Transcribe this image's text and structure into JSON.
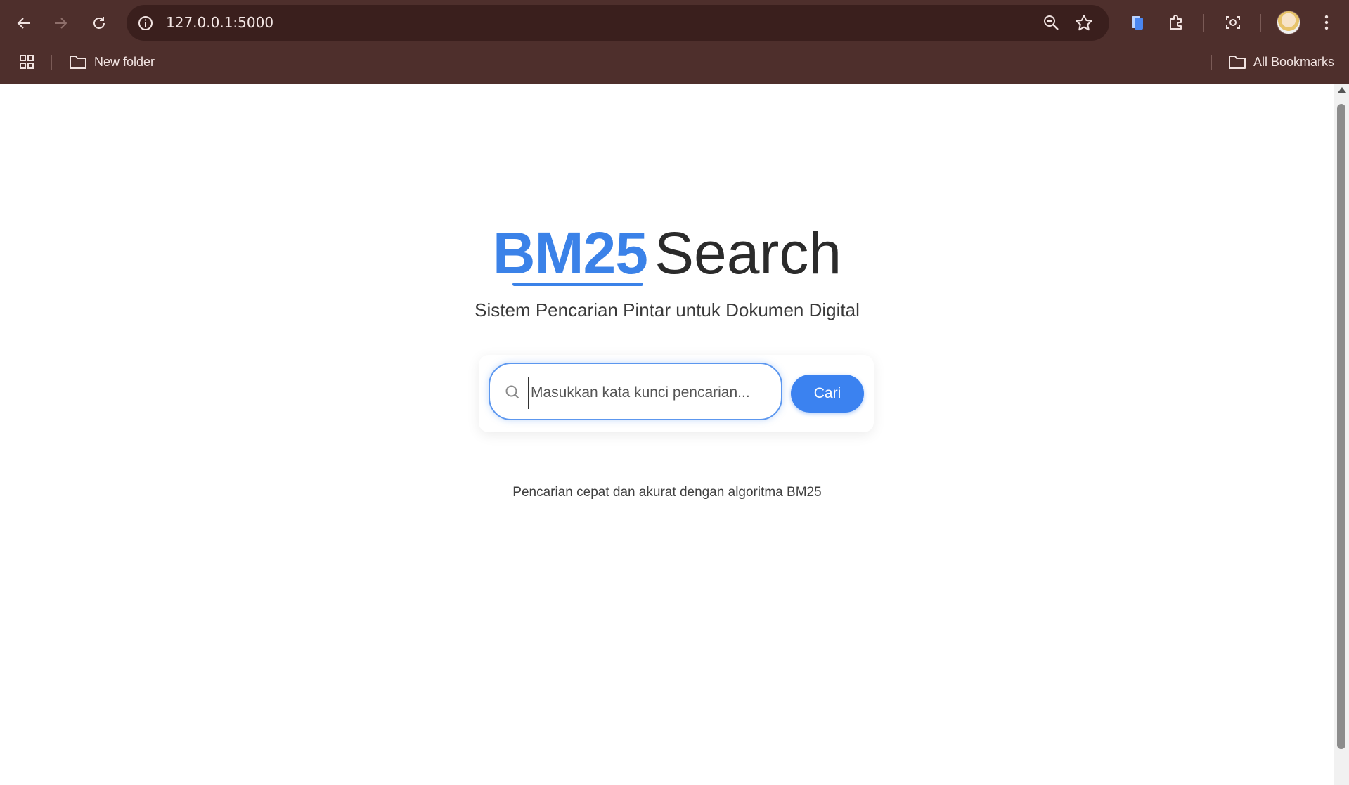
{
  "browser": {
    "url": "127.0.0.1:5000",
    "bookmarks": [
      {
        "label": "New folder"
      }
    ],
    "all_bookmarks_label": "All Bookmarks"
  },
  "page": {
    "logo_primary": "BM25",
    "logo_secondary": "Search",
    "subtitle": "Sistem Pencarian Pintar untuk Dokumen Digital",
    "search": {
      "placeholder": "Masukkan kata kunci pencarian...",
      "value": "",
      "button_label": "Cari"
    },
    "tagline": "Pencarian cepat dan akurat dengan algoritma BM25"
  },
  "colors": {
    "chrome_bg": "#4e2f2c",
    "omnibox_bg": "#3a1f1d",
    "accent": "#3b82f0"
  }
}
